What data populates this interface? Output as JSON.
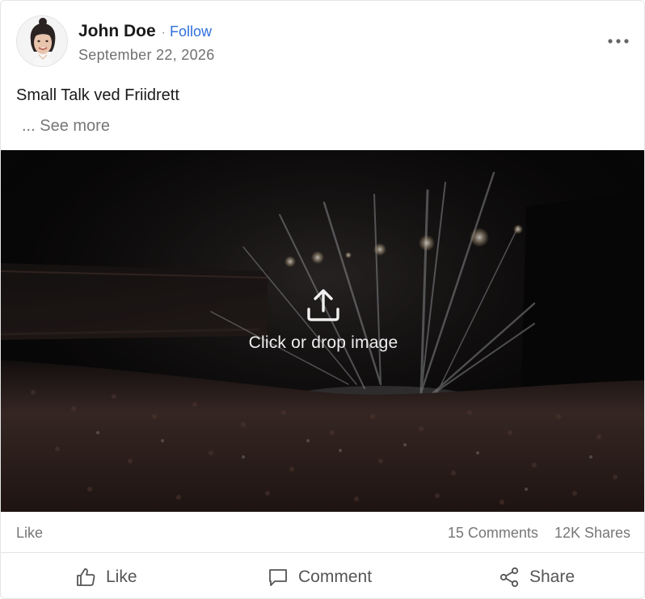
{
  "post": {
    "author": "John Doe",
    "separator": "·",
    "follow_label": "Follow",
    "date": "September 22, 2026",
    "text": "Small Talk ved Friidrett",
    "see_more": "... See more",
    "more_icon": "more-horizontal-icon"
  },
  "media": {
    "upload_icon": "upload-icon",
    "upload_label": "Click or drop image"
  },
  "stats": {
    "like": "Like",
    "comments": "15 Comments",
    "shares": "12K Shares"
  },
  "actions": [
    {
      "label": "Like",
      "icon": "thumbs-up-icon"
    },
    {
      "label": "Comment",
      "icon": "comment-icon"
    },
    {
      "label": "Share",
      "icon": "share-icon"
    }
  ],
  "colors": {
    "accent": "#2f6fdc",
    "muted_text": "#777777",
    "media_background": "#0b0a0a"
  }
}
